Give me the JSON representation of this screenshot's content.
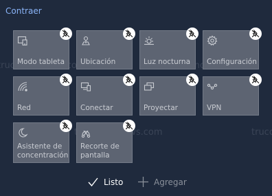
{
  "header": {
    "collapse_label": "Contraer"
  },
  "tiles": [
    {
      "label": "Modo tableta",
      "icon": "tablet-mode-icon"
    },
    {
      "label": "Ubicación",
      "icon": "location-icon"
    },
    {
      "label": "Luz nocturna",
      "icon": "night-light-icon"
    },
    {
      "label": "Configuración",
      "icon": "settings-gear-icon"
    },
    {
      "label": "Red",
      "icon": "network-icon"
    },
    {
      "label": "Conectar",
      "icon": "connect-icon"
    },
    {
      "label": "Proyectar",
      "icon": "project-icon"
    },
    {
      "label": "VPN",
      "icon": "vpn-icon"
    },
    {
      "label": "Asistente de concentración",
      "icon": "focus-assist-moon-icon"
    },
    {
      "label": "Recorte de pantalla",
      "icon": "screen-snip-icon"
    }
  ],
  "watermark": "trucoswindows.com",
  "footer": {
    "done_label": "Listo",
    "add_label": "Agregar"
  },
  "colors": {
    "background": "#1f2a3d",
    "tile": "#5d6472",
    "accent": "#8ab4f8"
  }
}
